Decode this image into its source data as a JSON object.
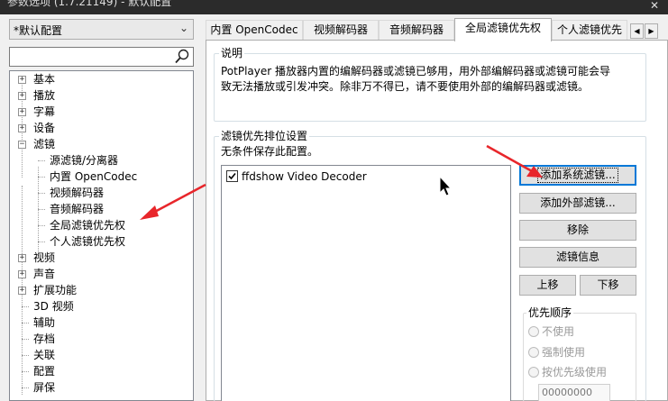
{
  "window": {
    "title": "参数选项 (1.7.21149) - 默认配置",
    "close_glyph": "✕"
  },
  "left": {
    "profile": "*默认配置",
    "search_value": "",
    "tree": [
      {
        "label": "基本",
        "level": 0,
        "expander": "+"
      },
      {
        "label": "播放",
        "level": 0,
        "expander": "+"
      },
      {
        "label": "字幕",
        "level": 0,
        "expander": "+"
      },
      {
        "label": "设备",
        "level": 0,
        "expander": "+"
      },
      {
        "label": "滤镜",
        "level": 0,
        "expander": "-"
      },
      {
        "label": "源滤镜/分离器",
        "level": 1
      },
      {
        "label": "内置 OpenCodec",
        "level": 1
      },
      {
        "label": "视频解码器",
        "level": 1
      },
      {
        "label": "音频解码器",
        "level": 1
      },
      {
        "label": "全局滤镜优先权",
        "level": 1
      },
      {
        "label": "个人滤镜优先权",
        "level": 1
      },
      {
        "label": "视频",
        "level": 0,
        "expander": "+"
      },
      {
        "label": "声音",
        "level": 0,
        "expander": "+"
      },
      {
        "label": "扩展功能",
        "level": 0,
        "expander": "+"
      },
      {
        "label": "3D 视频",
        "level": 0
      },
      {
        "label": "辅助",
        "level": 0
      },
      {
        "label": "存档",
        "level": 0
      },
      {
        "label": "关联",
        "level": 0
      },
      {
        "label": "配置",
        "level": 0
      },
      {
        "label": "屏保",
        "level": 0
      }
    ]
  },
  "tabs": [
    {
      "label": "内置 OpenCodec",
      "active": false
    },
    {
      "label": "视频解码器",
      "active": false
    },
    {
      "label": "音频解码器",
      "active": false
    },
    {
      "label": "全局滤镜优先权",
      "active": true
    },
    {
      "label": "个人滤镜优先",
      "active": false
    }
  ],
  "tab_scroll": {
    "left": "◀",
    "right": "▶"
  },
  "note": {
    "legend": "说明",
    "line1": "PotPlayer 播放器内置的编解码器或滤镜已够用，用外部编解码器或滤镜可能会导",
    "line2": "致无法播放或引发冲突。除非万不得已，请不要使用外部的编解码器或滤镜。"
  },
  "priority": {
    "legend": "滤镜优先排位设置",
    "hint": "无条件保存此配置。",
    "filters": [
      {
        "label": "ffdshow Video Decoder",
        "checked": true
      }
    ],
    "buttons": {
      "add_system": "添加系统滤镜...",
      "add_external": "添加外部滤镜...",
      "remove": "移除",
      "info": "滤镜信息",
      "up": "上移",
      "down": "下移"
    },
    "order": {
      "legend": "优先顺序",
      "options": [
        "不使用",
        "强制使用",
        "按优先级使用"
      ],
      "value": "00000000"
    }
  },
  "colors": {
    "annotation_arrow": "#e8262b",
    "focus_blue": "#0078d7"
  }
}
